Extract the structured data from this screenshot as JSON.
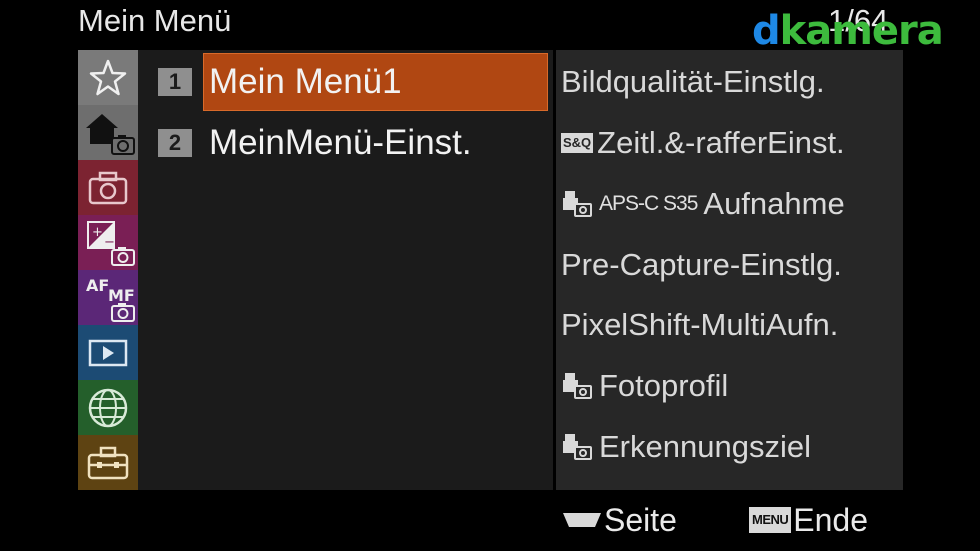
{
  "header": {
    "title": "Mein Menü",
    "page_counter": "1/64"
  },
  "logo": {
    "d": "d",
    "rest": "kamera"
  },
  "categories": [
    {
      "name": "my-menu",
      "icon": "star-icon",
      "color": "#777777",
      "selected": true
    },
    {
      "name": "home",
      "icon": "home-camera-icon",
      "color": "#6b6b6b"
    },
    {
      "name": "shooting",
      "icon": "camera-icon",
      "color": "#7c2331"
    },
    {
      "name": "exposure",
      "icon": "exposure-camera-icon",
      "color": "#7a1f55"
    },
    {
      "name": "focus",
      "icon": "af-mf-icon",
      "color": "#5b2777"
    },
    {
      "name": "playback",
      "icon": "play-icon",
      "color": "#1c4b74"
    },
    {
      "name": "network",
      "icon": "globe-icon",
      "color": "#245f2b"
    },
    {
      "name": "setup",
      "icon": "toolbox-icon",
      "color": "#5e4312"
    }
  ],
  "my_menu": {
    "items": [
      {
        "num": "1",
        "label": "Mein Menü1",
        "selected": true
      },
      {
        "num": "2",
        "label": "MeinMenü-Einst."
      }
    ]
  },
  "sub_menu": {
    "items": [
      {
        "label": "Bildqualität-Einstlg."
      },
      {
        "badge": "S&Q",
        "label": "Zeitl.&-rafferEinst."
      },
      {
        "prefix": "APS-C S35",
        "label": "Aufnahme",
        "icon": "photo-mode-icon"
      },
      {
        "label": "Pre-Capture-Einstlg."
      },
      {
        "label": "PixelShift-MultiAufn."
      },
      {
        "label": "Fotoprofil",
        "icon": "photo-mode-icon"
      },
      {
        "label": "Erkennungsziel",
        "icon": "photo-mode-icon"
      }
    ]
  },
  "footer": {
    "page_label": "Seite",
    "menu_badge": "MENU",
    "end_label": "Ende"
  }
}
